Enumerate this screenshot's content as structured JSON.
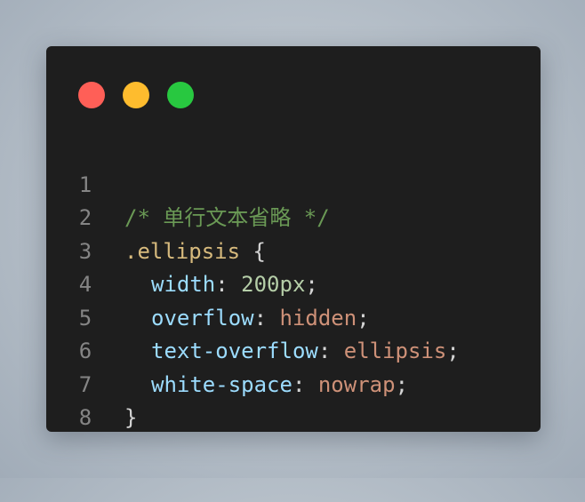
{
  "window_controls": [
    {
      "name": "close",
      "color": "#ff5f57"
    },
    {
      "name": "minimize",
      "color": "#febc2e"
    },
    {
      "name": "maximize",
      "color": "#28c840"
    }
  ],
  "code": {
    "line_numbers": [
      "1",
      "2",
      "3",
      "4",
      "5",
      "6",
      "7",
      "8"
    ],
    "lines": {
      "comment": "/* 单行文本省略 */",
      "selector": ".ellipsis",
      "open_brace": " {",
      "close_brace": "}",
      "width": {
        "property": "width",
        "value": "200px"
      },
      "overflow": {
        "property": "overflow",
        "value": "hidden"
      },
      "text_overflow": {
        "property": "text-overflow",
        "value": "ellipsis"
      },
      "white_space": {
        "property": "white-space",
        "value": "nowrap"
      }
    },
    "colon": ": ",
    "semicolon": ";"
  }
}
